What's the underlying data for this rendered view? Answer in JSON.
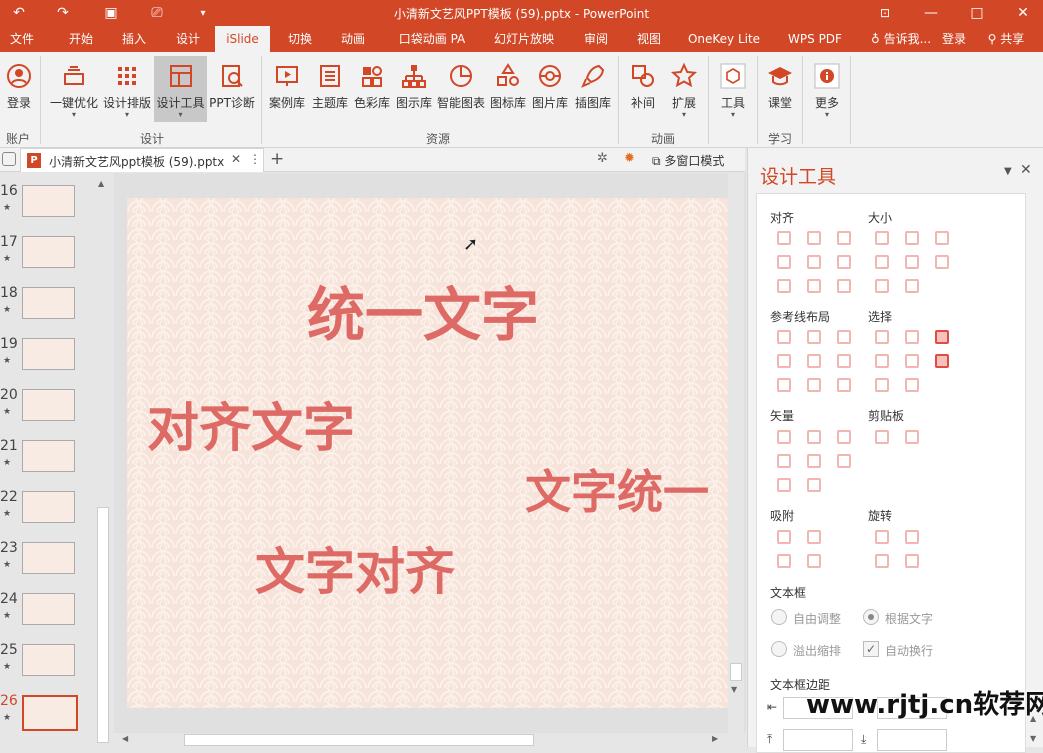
{
  "titlebar": {
    "title": "小清新文艺风PPT模板 (59).pptx - PowerPoint"
  },
  "tabs": [
    "文件",
    "开始",
    "插入",
    "设计",
    "iSlide",
    "切换",
    "动画",
    "口袋动画 PA",
    "幻灯片放映",
    "审阅",
    "视图",
    "OneKey Lite",
    "WPS PDF"
  ],
  "tell_me": "告诉我...",
  "login_link": "登录",
  "share": "共享",
  "ribbon": {
    "buttons": [
      "登录",
      "一键优化",
      "设计排版",
      "设计工具",
      "PPT诊断",
      "案例库",
      "主题库",
      "色彩库",
      "图示库",
      "智能图表",
      "图标库",
      "图片库",
      "插图库",
      "补间",
      "扩展",
      "工具",
      "课堂",
      "更多"
    ],
    "groups": [
      "账户",
      "设计",
      "资源",
      "动画",
      "学习"
    ]
  },
  "filetab": {
    "name": "小清新文艺风ppt模板 (59).pptx",
    "multiwindow": "多窗口模式"
  },
  "thumbs": [
    "16",
    "17",
    "18",
    "19",
    "20",
    "21",
    "22",
    "23",
    "24",
    "25",
    "26"
  ],
  "slide": {
    "texts": [
      "统一文字",
      "对齐文字",
      "文字统一",
      "文字对齐"
    ]
  },
  "panel": {
    "title": "设计工具",
    "sections": {
      "align": "对齐",
      "size": "大小",
      "guides": "参考线布局",
      "select": "选择",
      "vector": "矢量",
      "clipboard": "剪贴板",
      "snap": "吸附",
      "rotate": "旋转",
      "textbox": "文本框",
      "margin": "文本框边距"
    },
    "textbox_options": [
      "自由调整",
      "根据文字",
      "溢出缩排",
      "自动换行"
    ]
  },
  "watermark": "www.rjtj.cn软荐网",
  "colors": {
    "accent": "#d24726",
    "slide_text": "#de6a66",
    "slide_bg": "#f6e4da"
  }
}
